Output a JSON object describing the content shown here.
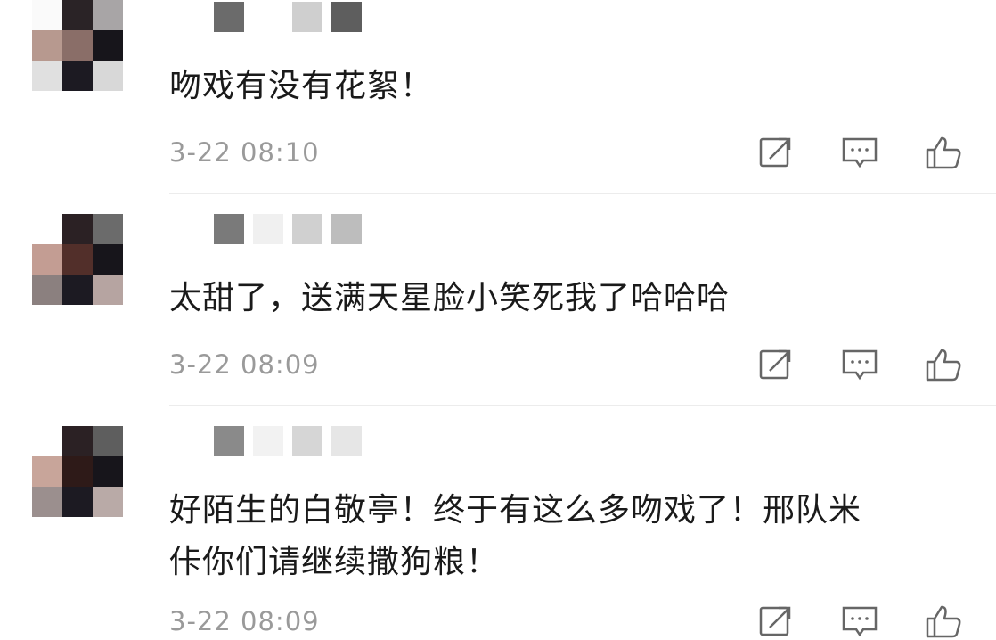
{
  "comments": [
    {
      "text": "吻戏有没有花絮！",
      "time": "3-22 08:10"
    },
    {
      "text": "太甜了，送满天星脸小笑死我了哈哈哈",
      "time": "3-22 08:09"
    },
    {
      "text": "好陌生的白敬亭！终于有这么多吻戏了！邢队米\n佧你们请继续撒狗粮！",
      "time": "3-22 08:09"
    }
  ],
  "icons": {
    "share": "share-icon",
    "reply": "comment-icon",
    "like": "thumbs-up-icon"
  },
  "colors": {
    "text": "#1a1a1a",
    "time": "#9a9a9a",
    "divider": "#ececec",
    "icon": "#666666"
  }
}
